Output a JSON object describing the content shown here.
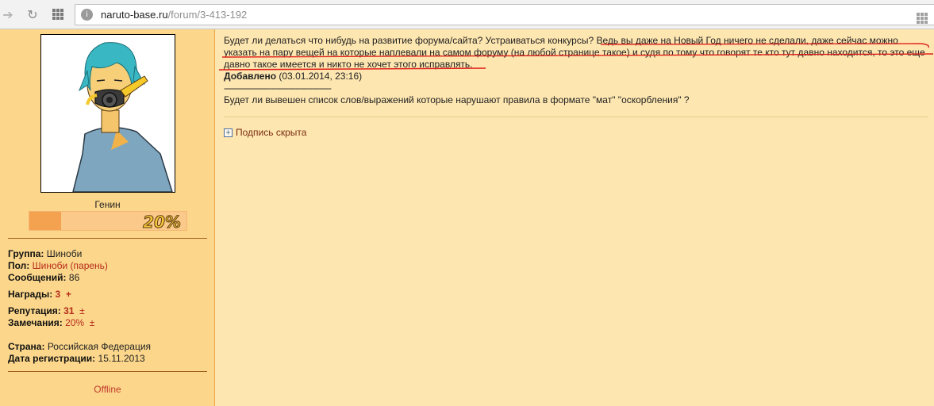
{
  "browser": {
    "url_host": "naruto-base.ru",
    "url_path": "/forum/3-413-192",
    "back_icon": "back-arrow-icon",
    "reload_icon": "reload-icon",
    "apps_icon": "apps-grid-icon"
  },
  "profile": {
    "rank": "Генин",
    "rank_progress_label": "20%",
    "rank_progress": 0.2,
    "fields": {
      "group_label": "Группа:",
      "group_value": "Шиноби",
      "gender_label": "Пол:",
      "gender_value": "Шиноби (парень)",
      "messages_label": "Сообщений:",
      "messages_value": "86",
      "awards_label": "Награды:",
      "awards_value": "3",
      "awards_plus": "+",
      "reputation_label": "Репутация:",
      "reputation_value": "31",
      "reputation_pm": "±",
      "remarks_label": "Замечания:",
      "remarks_value": "20%",
      "remarks_pm": "±",
      "country_label": "Страна:",
      "country_value": "Российская Федерация",
      "regdate_label": "Дата регистрации:",
      "regdate_value": "15.11.2013"
    },
    "status": "Offline"
  },
  "post": {
    "line1": "Будет ли делаться что нибудь на развитие форума/сайта? Устраиваться конкурсы? Ведь вы даже на Новый Год ничего не сделали, даже сейчас можно",
    "line2": "указать на пару вещей на которые наплевали на самом форуму (на любой странице такое) и судя по тому что говорят те кто тут давно находится, то это еще",
    "line3": "давно такое имеется и никто не хочет этого исправлять.",
    "added_label": "Добавлено",
    "added_date": "(03.01.2014, 23:16)",
    "dashes": "---------------------------------------------",
    "line4": "Будет ли вывешен список слов/выражений которые нарушают правила в формате \"мат\" \"оскорбления\" ?",
    "signature_toggle": "+",
    "signature_label": "Подпись скрыта"
  },
  "colors": {
    "sidebar_bg": "#fcd78b",
    "content_bg": "#fde6b0",
    "link_red": "#b52a1a",
    "annotation_red": "#e0201a"
  }
}
